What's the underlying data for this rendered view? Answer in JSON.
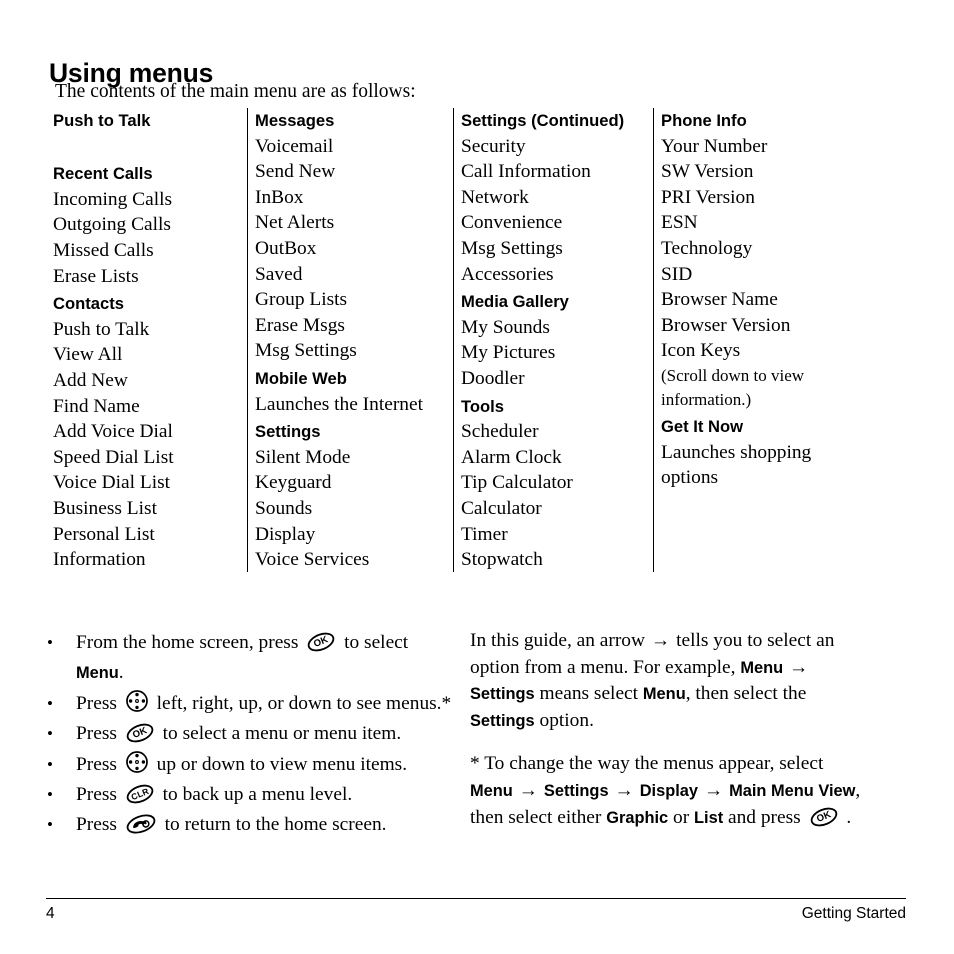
{
  "page": {
    "title": "Using menus",
    "intro": "The contents of the main menu are as follows:"
  },
  "menu_table": {
    "columns": [
      {
        "id": "column-1",
        "entries": [
          {
            "type": "heading",
            "text": "Push to Talk"
          },
          {
            "type": "gap"
          },
          {
            "type": "heading",
            "text": "Recent Calls"
          },
          {
            "type": "item",
            "text": "Incoming Calls"
          },
          {
            "type": "item",
            "text": "Outgoing Calls"
          },
          {
            "type": "item",
            "text": "Missed Calls"
          },
          {
            "type": "item",
            "text": "Erase Lists"
          },
          {
            "type": "heading",
            "text": "Contacts"
          },
          {
            "type": "item",
            "text": "Push to Talk"
          },
          {
            "type": "item",
            "text": "View All"
          },
          {
            "type": "item",
            "text": "Add New"
          },
          {
            "type": "item",
            "text": "Find Name"
          },
          {
            "type": "item",
            "text": "Add Voice Dial"
          },
          {
            "type": "item",
            "text": "Speed Dial List"
          },
          {
            "type": "item",
            "text": "Voice Dial List"
          },
          {
            "type": "item",
            "text": "Business List"
          },
          {
            "type": "item",
            "text": "Personal List"
          },
          {
            "type": "item",
            "text": "Information"
          }
        ]
      },
      {
        "id": "column-2",
        "entries": [
          {
            "type": "heading",
            "text": "Messages"
          },
          {
            "type": "item",
            "text": "Voicemail"
          },
          {
            "type": "item",
            "text": "Send New"
          },
          {
            "type": "item",
            "text": "InBox"
          },
          {
            "type": "item",
            "text": "Net Alerts"
          },
          {
            "type": "item",
            "text": "OutBox"
          },
          {
            "type": "item",
            "text": "Saved"
          },
          {
            "type": "item",
            "text": "Group Lists"
          },
          {
            "type": "item",
            "text": "Erase Msgs"
          },
          {
            "type": "item",
            "text": "Msg Settings"
          },
          {
            "type": "heading",
            "text": "Mobile Web"
          },
          {
            "type": "item",
            "text": "Launches the Internet"
          },
          {
            "type": "heading",
            "text": "Settings"
          },
          {
            "type": "item",
            "text": "Silent Mode"
          },
          {
            "type": "item",
            "text": "Keyguard"
          },
          {
            "type": "item",
            "text": "Sounds"
          },
          {
            "type": "item",
            "text": "Display"
          },
          {
            "type": "item",
            "text": "Voice Services"
          }
        ]
      },
      {
        "id": "column-3",
        "entries": [
          {
            "type": "heading",
            "text": "Settings (Continued)"
          },
          {
            "type": "item",
            "text": "Security"
          },
          {
            "type": "item",
            "text": "Call Information"
          },
          {
            "type": "item",
            "text": "Network"
          },
          {
            "type": "item",
            "text": "Convenience"
          },
          {
            "type": "item",
            "text": "Msg Settings"
          },
          {
            "type": "item",
            "text": "Accessories"
          },
          {
            "type": "heading",
            "text": "Media Gallery"
          },
          {
            "type": "item",
            "text": "My Sounds"
          },
          {
            "type": "item",
            "text": "My Pictures"
          },
          {
            "type": "item",
            "text": "Doodler"
          },
          {
            "type": "heading",
            "text": "Tools"
          },
          {
            "type": "item",
            "text": "Scheduler"
          },
          {
            "type": "item",
            "text": "Alarm Clock"
          },
          {
            "type": "item",
            "text": "Tip Calculator"
          },
          {
            "type": "item",
            "text": "Calculator"
          },
          {
            "type": "item",
            "text": "Timer"
          },
          {
            "type": "item",
            "text": "Stopwatch"
          }
        ]
      },
      {
        "id": "column-4",
        "entries": [
          {
            "type": "heading",
            "text": "Phone Info"
          },
          {
            "type": "item",
            "text": "Your Number"
          },
          {
            "type": "item",
            "text": "SW Version"
          },
          {
            "type": "item",
            "text": "PRI Version"
          },
          {
            "type": "item",
            "text": "ESN"
          },
          {
            "type": "item",
            "text": "Technology"
          },
          {
            "type": "item",
            "text": "SID"
          },
          {
            "type": "item",
            "text": "Browser Name"
          },
          {
            "type": "item",
            "text": "Browser Version"
          },
          {
            "type": "item",
            "text": "Icon Keys"
          },
          {
            "type": "note",
            "text": "(Scroll down to view"
          },
          {
            "type": "note",
            "text": "information.)"
          },
          {
            "type": "heading",
            "text": "Get It Now"
          },
          {
            "type": "item",
            "text": "Launches shopping"
          },
          {
            "type": "item",
            "text": "options"
          }
        ]
      }
    ]
  },
  "bullets": [
    {
      "id": "bullet-home-screen",
      "parts": [
        {
          "kind": "text",
          "value": "From the home screen, press "
        },
        {
          "kind": "icon",
          "value": "ok-key-icon"
        },
        {
          "kind": "text",
          "value": " to select "
        },
        {
          "kind": "bold",
          "value": "Menu"
        },
        {
          "kind": "text",
          "value": "."
        }
      ]
    },
    {
      "id": "bullet-navigate-menus",
      "parts": [
        {
          "kind": "text",
          "value": "Press "
        },
        {
          "kind": "icon",
          "value": "navigation-key-icon"
        },
        {
          "kind": "text",
          "value": " left, right, up, or down to see menus.*"
        }
      ]
    },
    {
      "id": "bullet-select-item",
      "parts": [
        {
          "kind": "text",
          "value": "Press "
        },
        {
          "kind": "icon",
          "value": "ok-key-icon"
        },
        {
          "kind": "text",
          "value": " to select a menu or menu item."
        }
      ]
    },
    {
      "id": "bullet-view-items",
      "parts": [
        {
          "kind": "text",
          "value": "Press "
        },
        {
          "kind": "icon",
          "value": "navigation-key-icon"
        },
        {
          "kind": "text",
          "value": " up or down to view menu items."
        }
      ]
    },
    {
      "id": "bullet-back-up",
      "parts": [
        {
          "kind": "text",
          "value": "Press "
        },
        {
          "kind": "icon",
          "value": "clear-key-icon"
        },
        {
          "kind": "text",
          "value": " to back up a menu level."
        }
      ]
    },
    {
      "id": "bullet-return-home",
      "parts": [
        {
          "kind": "text",
          "value": "Press "
        },
        {
          "kind": "icon",
          "value": "end-key-icon"
        },
        {
          "kind": "text",
          "value": " to return to the home screen."
        }
      ]
    }
  ],
  "right_block": {
    "paragraph_1": [
      {
        "kind": "text",
        "value": "In this guide, an arrow "
      },
      {
        "kind": "arrow",
        "value": "→"
      },
      {
        "kind": "text",
        "value": " tells you to select an option from a menu. For example, "
      },
      {
        "kind": "bold",
        "value": "Menu"
      },
      {
        "kind": "text",
        "value": " "
      },
      {
        "kind": "arrow",
        "value": "→"
      },
      {
        "kind": "text",
        "value": " "
      },
      {
        "kind": "bold",
        "value": "Settings"
      },
      {
        "kind": "text",
        "value": " means select "
      },
      {
        "kind": "bold",
        "value": "Menu"
      },
      {
        "kind": "text",
        "value": ", then select the "
      },
      {
        "kind": "bold",
        "value": "Settings"
      },
      {
        "kind": "text",
        "value": " option."
      }
    ],
    "paragraph_2": [
      {
        "kind": "text",
        "value": "* To change the way the menus appear, select "
      },
      {
        "kind": "bold",
        "value": "Menu"
      },
      {
        "kind": "text",
        "value": " "
      },
      {
        "kind": "arrow",
        "value": "→"
      },
      {
        "kind": "text",
        "value": " "
      },
      {
        "kind": "bold",
        "value": "Settings"
      },
      {
        "kind": "text",
        "value": " "
      },
      {
        "kind": "arrow",
        "value": "→"
      },
      {
        "kind": "text",
        "value": " "
      },
      {
        "kind": "bold",
        "value": "Display"
      },
      {
        "kind": "text",
        "value": " "
      },
      {
        "kind": "arrow",
        "value": "→"
      },
      {
        "kind": "text",
        "value": " "
      },
      {
        "kind": "bold",
        "value": "Main Menu View"
      },
      {
        "kind": "text",
        "value": ", then select either "
      },
      {
        "kind": "bold",
        "value": "Graphic"
      },
      {
        "kind": "text",
        "value": " or "
      },
      {
        "kind": "bold",
        "value": "List"
      },
      {
        "kind": "text",
        "value": " and press "
      },
      {
        "kind": "icon",
        "value": "ok-key-icon"
      },
      {
        "kind": "text",
        "value": " ."
      }
    ]
  },
  "footer": {
    "page_number": "4",
    "section": "Getting Started"
  },
  "icon_labels": {
    "ok-key-icon": "OK",
    "clear-key-icon": "CLR",
    "navigation-key-icon": "navigation",
    "end-key-icon": "end-call"
  }
}
